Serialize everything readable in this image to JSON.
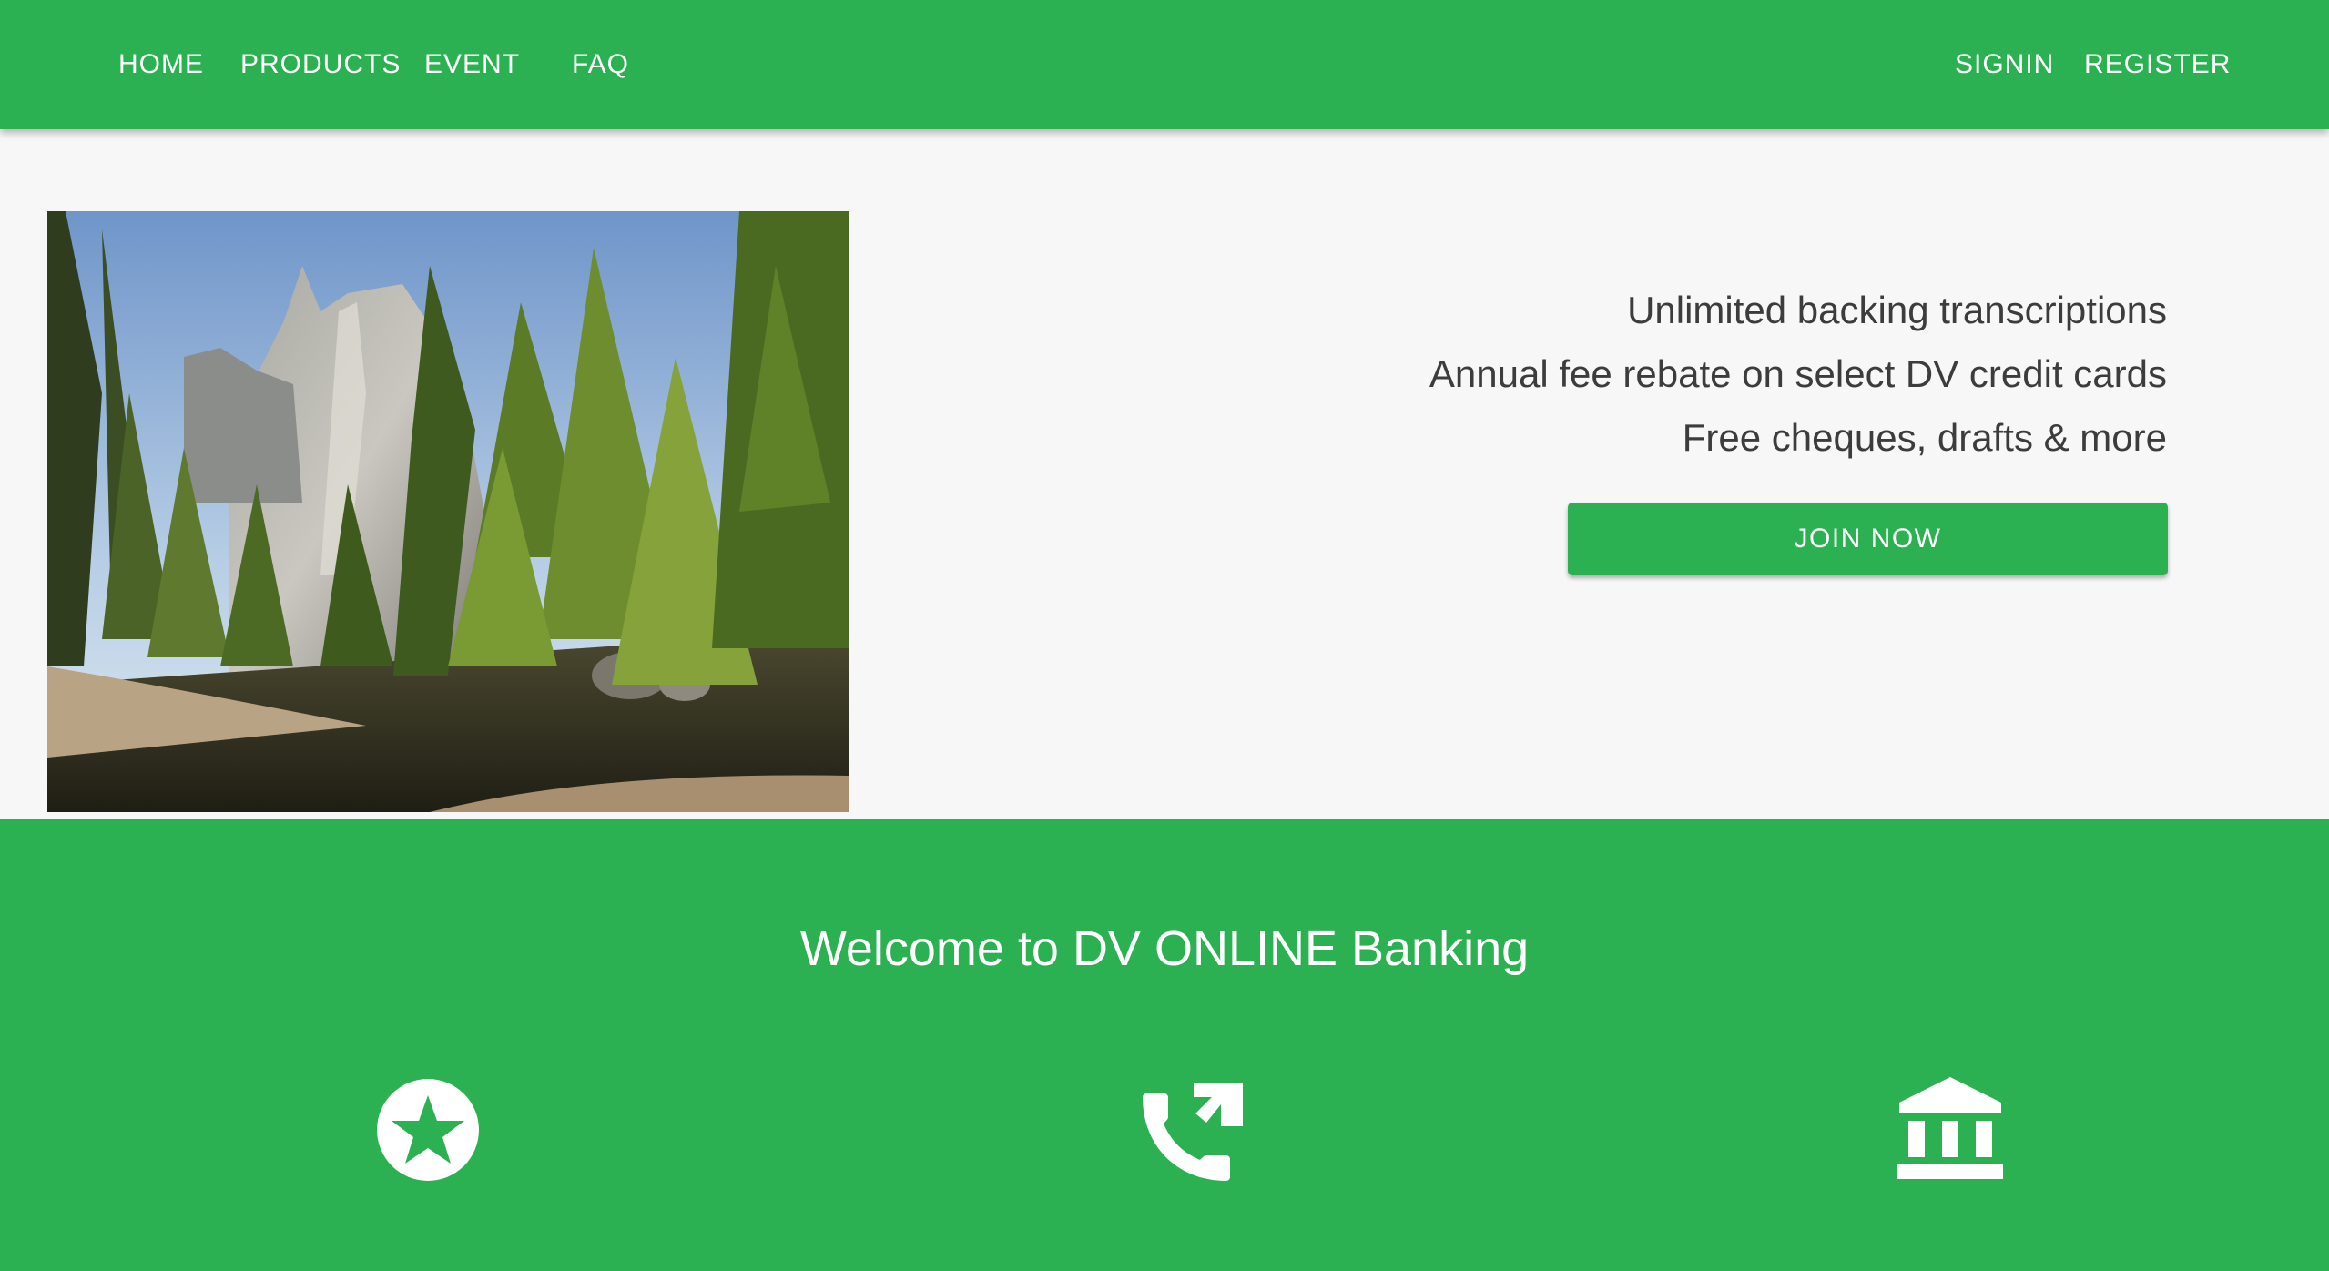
{
  "nav": {
    "left": [
      {
        "label": "HOME"
      },
      {
        "label": "PRODUCTS"
      },
      {
        "label": "EVENT"
      },
      {
        "label": "FAQ"
      }
    ],
    "right": [
      {
        "label": "SIGNIN"
      },
      {
        "label": "REGISTER"
      }
    ]
  },
  "hero": {
    "perks": [
      "Unlimited backing transcriptions",
      "Annual fee rebate on select DV credit cards",
      "Free cheques, drafts & more"
    ],
    "join_label": "JOIN NOW"
  },
  "welcome": {
    "title": "Welcome to DV ONLINE Banking",
    "features": [
      {
        "icon": "star-circle-icon"
      },
      {
        "icon": "phone-callback-icon"
      },
      {
        "icon": "bank-icon"
      }
    ]
  },
  "colors": {
    "brand": "#2bb152",
    "background": "#f7f7f7",
    "text": "#3c3c3c"
  }
}
